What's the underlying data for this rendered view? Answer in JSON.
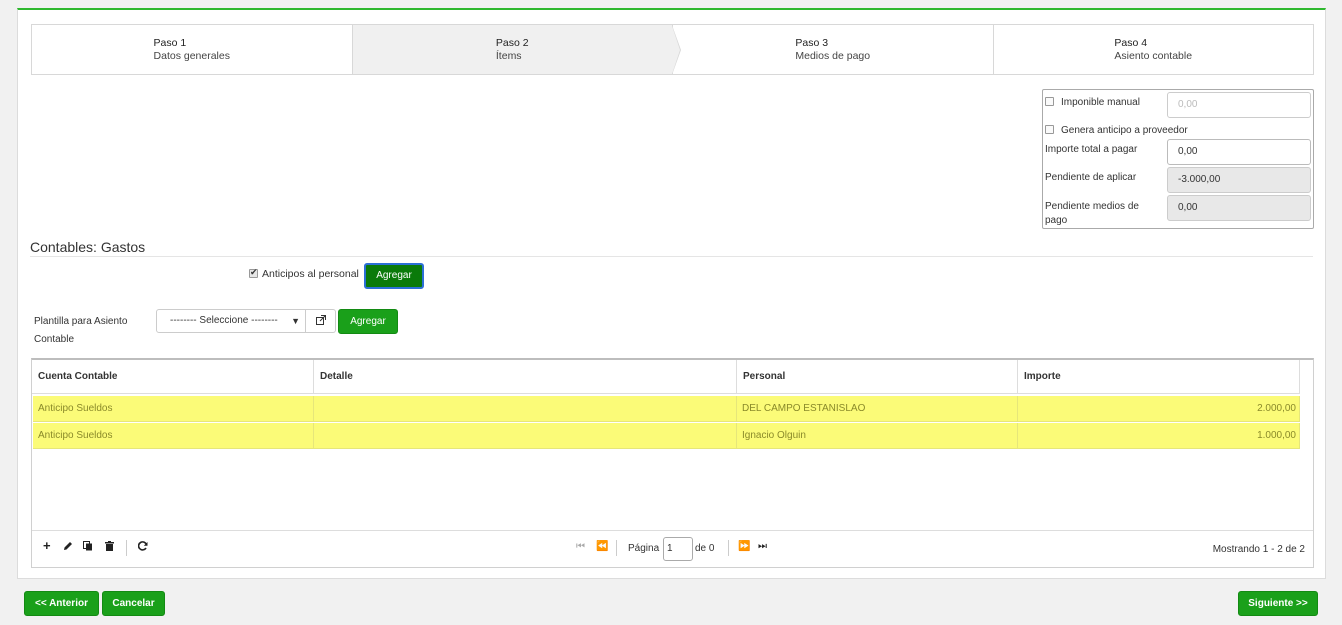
{
  "wizard": {
    "steps": [
      {
        "num": "Paso 1",
        "name": "Datos generales"
      },
      {
        "num": "Paso 2",
        "name": "Ítems"
      },
      {
        "num": "Paso 3",
        "name": "Medios de pago"
      },
      {
        "num": "Paso 4",
        "name": "Asiento contable"
      }
    ],
    "active_step": 2
  },
  "summary": {
    "imponible_manual_label": "Imponible manual",
    "imponible_manual_checked": false,
    "imponible_manual_placeholder": "0,00",
    "genera_anticipo_label": "Genera anticipo a proveedor",
    "genera_anticipo_checked": false,
    "importe_total_label": "Importe total a pagar",
    "importe_total_value": "0,00",
    "pendiente_aplicar_label": "Pendiente de aplicar",
    "pendiente_aplicar_value": "-3.000,00",
    "pendiente_medios_label": "Pendiente medios de pago",
    "pendiente_medios_value": "0,00"
  },
  "section": {
    "title": "Contables: Gastos",
    "anticipos_label": "Anticipos al personal",
    "anticipos_checked": true,
    "agregar_label": "Agregar",
    "plantilla_label": "Plantilla para Asiento Contable",
    "plantilla_select_value": "-------- Seleccione --------",
    "plantilla_agregar_label": "Agregar"
  },
  "grid": {
    "columns": [
      "Cuenta Contable",
      "Detalle",
      "Personal",
      "Importe"
    ],
    "rows": [
      {
        "cuenta": "Anticipo Sueldos",
        "detalle": "",
        "personal": "DEL CAMPO ESTANISLAO",
        "importe": "2.000,00"
      },
      {
        "cuenta": "Anticipo Sueldos",
        "detalle": "",
        "personal": "Ignacio Olguin",
        "importe": "1.000,00"
      }
    ],
    "footer": {
      "pagina_label": "Página",
      "page_value": "1",
      "de_label": "de 0",
      "count_text": "Mostrando 1 - 2 de 2"
    }
  },
  "nav": {
    "anterior_label": "<< Anterior",
    "cancelar_label": "Cancelar",
    "siguiente_label": "Siguiente >>"
  },
  "colors": {
    "accent_green": "#1aa01a",
    "row_highlight": "#fbfb78"
  }
}
